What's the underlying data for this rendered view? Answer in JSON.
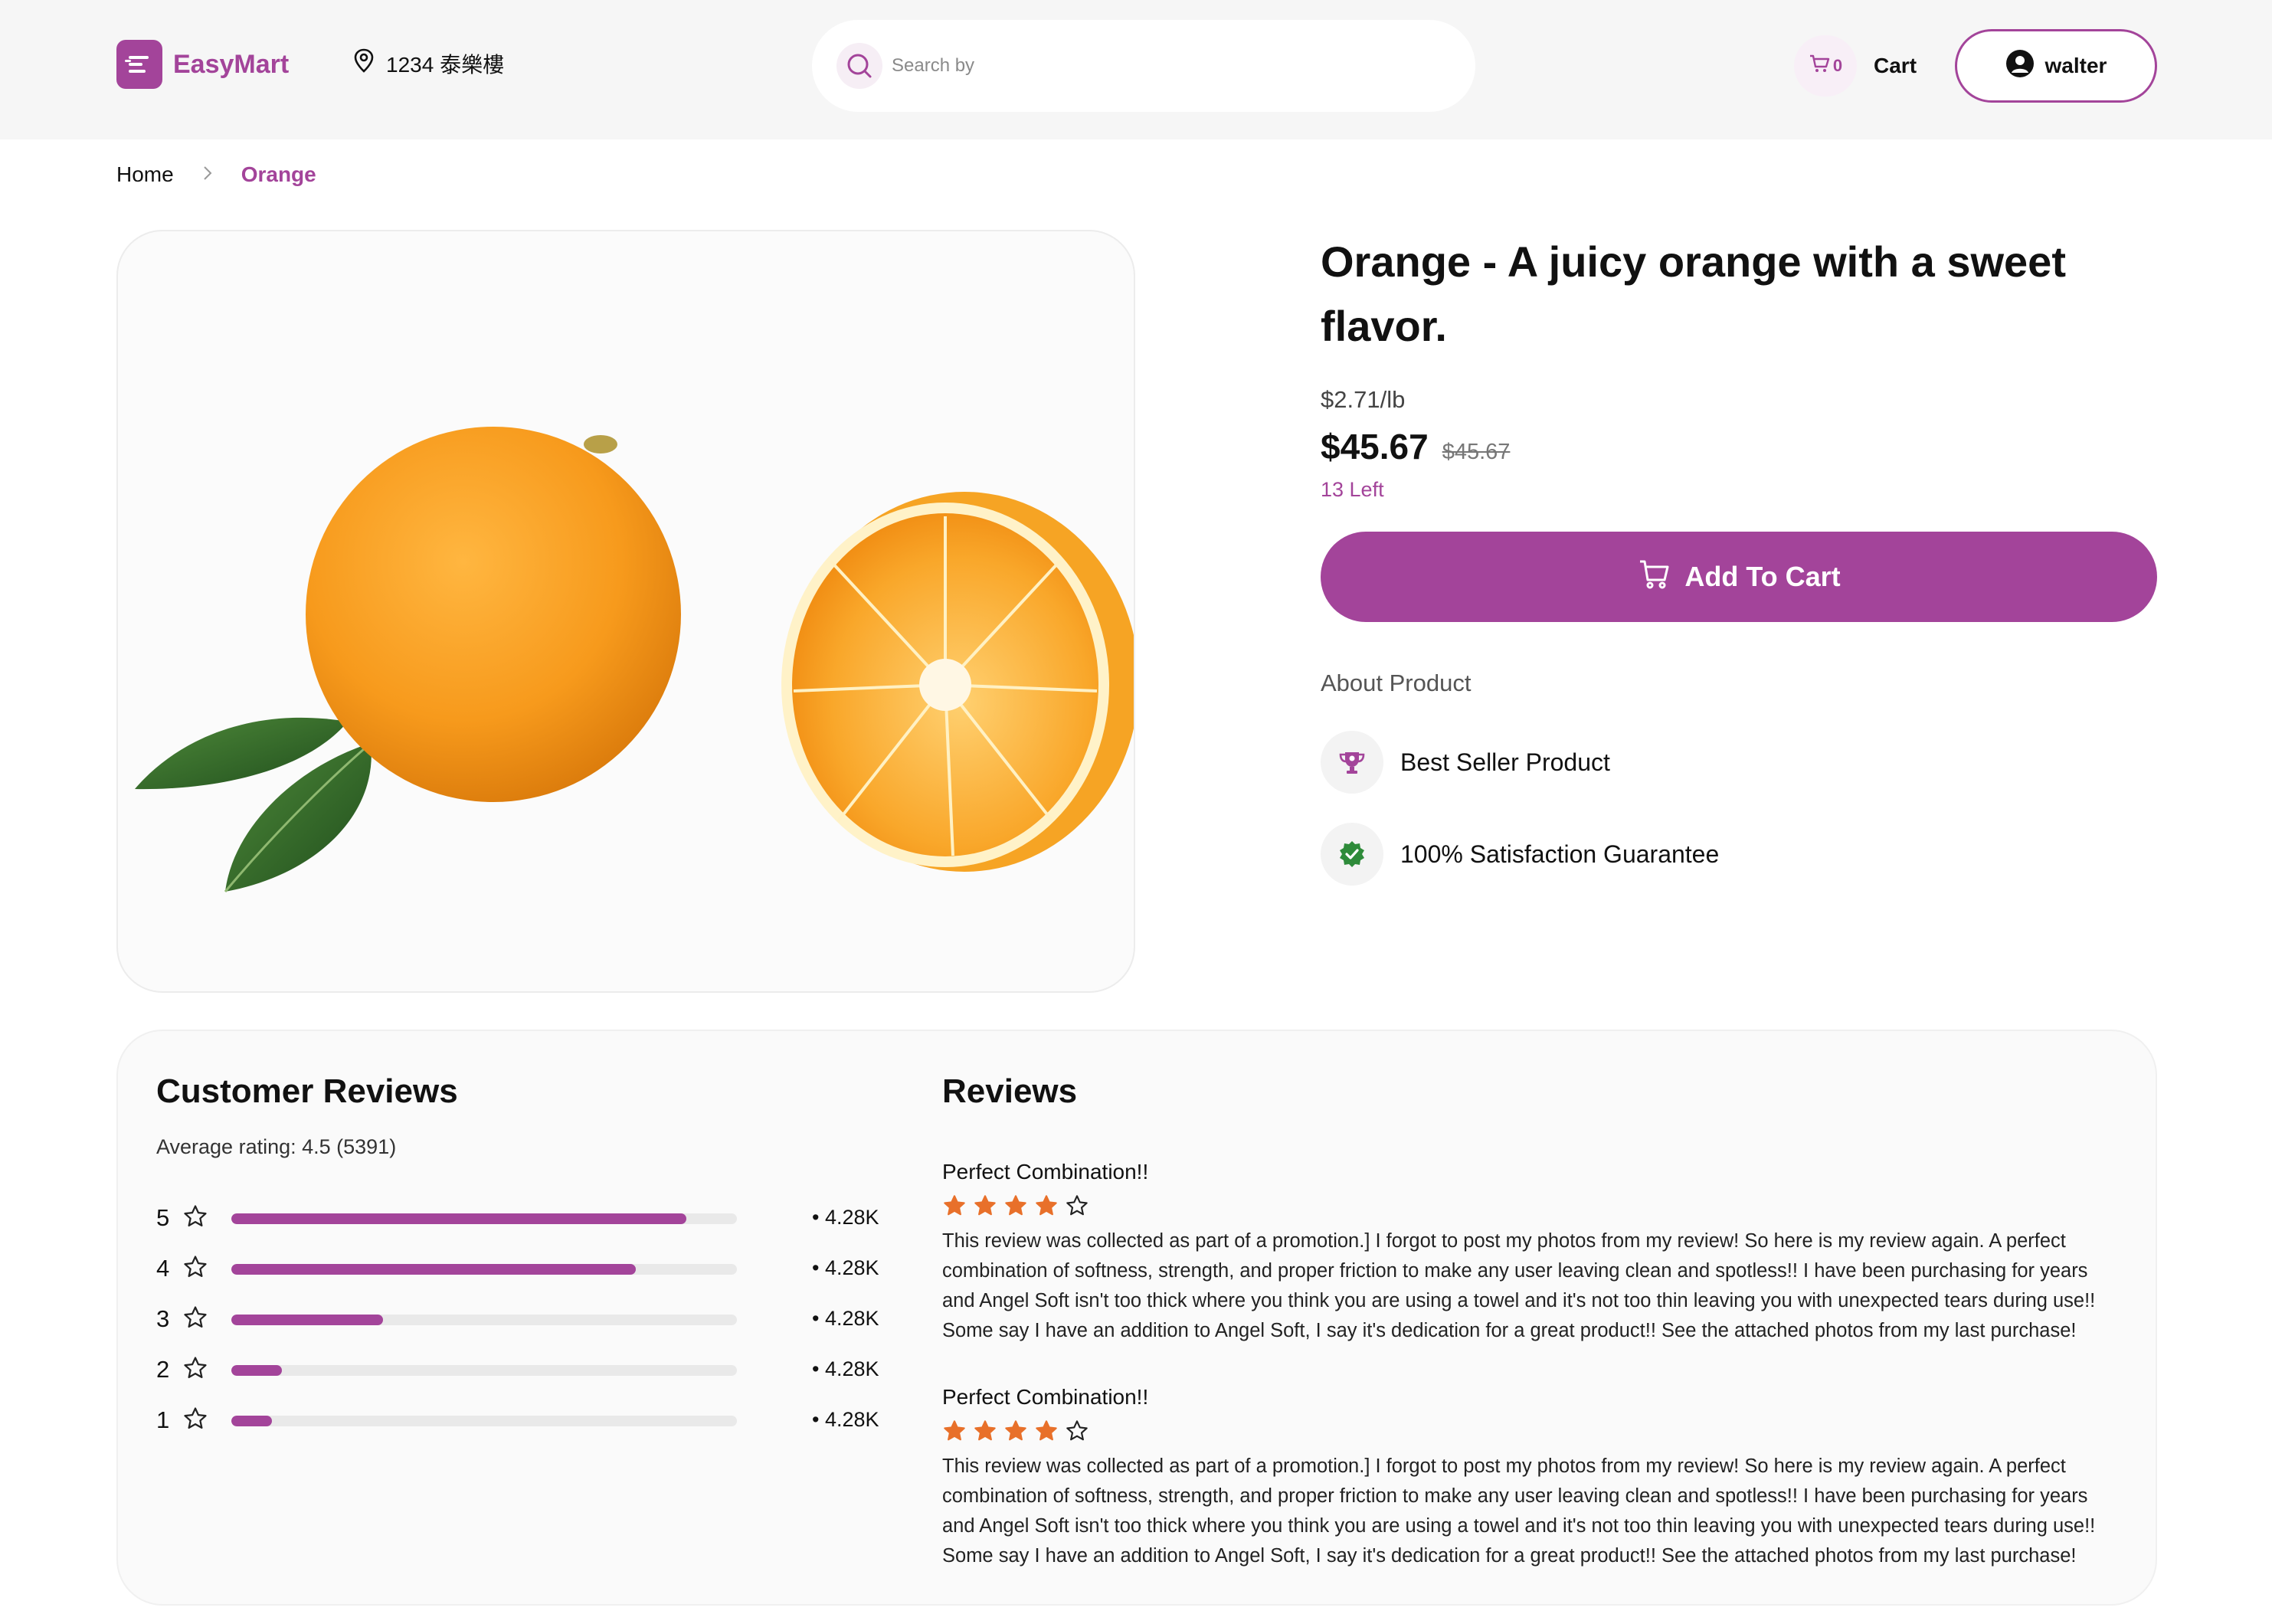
{
  "header": {
    "brand": "EasyMart",
    "location": "1234 泰樂樓",
    "search_placeholder": "Search by",
    "cart_count": "0",
    "cart_label": "Cart",
    "user_name": "walter"
  },
  "breadcrumb": {
    "home": "Home",
    "current": "Orange"
  },
  "product": {
    "title": "Orange - A juicy orange with a sweet flavor.",
    "unit_price": "$2.71/lb",
    "price": "$45.67",
    "original_price": "$45.67",
    "stock": "13 Left",
    "add_to_cart": "Add To Cart",
    "about_label": "About Product",
    "features": [
      {
        "label": "Best Seller Product",
        "icon": "trophy-icon"
      },
      {
        "label": "100% Satisfaction Guarantee",
        "icon": "verified-badge-icon"
      }
    ]
  },
  "customer_reviews": {
    "title": "Customer Reviews",
    "average": "Average rating: 4.5 (5391)",
    "breakdown": [
      {
        "stars": "5",
        "fraction": 0.9,
        "count": "• 4.28K"
      },
      {
        "stars": "4",
        "fraction": 0.8,
        "count": "• 4.28K"
      },
      {
        "stars": "3",
        "fraction": 0.3,
        "count": "• 4.28K"
      },
      {
        "stars": "2",
        "fraction": 0.1,
        "count": "• 4.28K"
      },
      {
        "stars": "1",
        "fraction": 0.08,
        "count": "• 4.28K"
      }
    ]
  },
  "reviews": {
    "title": "Reviews",
    "items": [
      {
        "heading": "Perfect Combination!!",
        "rating": 4,
        "body": "This review was collected as part of a promotion.] I forgot to post my photos from my review! So here is my review again. A perfect combination of softness, strength, and proper friction to make any user leaving clean and spotless!! I have been purchasing for years and Angel Soft isn't too thick where you think you are using a towel and it's not too thin leaving you with unexpected tears during use!! Some say I have an addition to Angel Soft, I say it's dedication for a great product!! See the attached photos from my last purchase!"
      },
      {
        "heading": "Perfect Combination!!",
        "rating": 4,
        "body": "This review was collected as part of a promotion.] I forgot to post my photos from my review! So here is my review again. A perfect combination of softness, strength, and proper friction to make any user leaving clean and spotless!! I have been purchasing for years and Angel Soft isn't too thick where you think you are using a towel and it's not too thin leaving you with unexpected tears during use!! Some say I have an addition to Angel Soft, I say it's dedication for a great product!! See the attached photos from my last purchase!"
      }
    ]
  },
  "colors": {
    "accent": "#a3449a",
    "star": "#e8702a",
    "verified": "#2e8b3a",
    "header_bg": "#f6f6f6"
  }
}
